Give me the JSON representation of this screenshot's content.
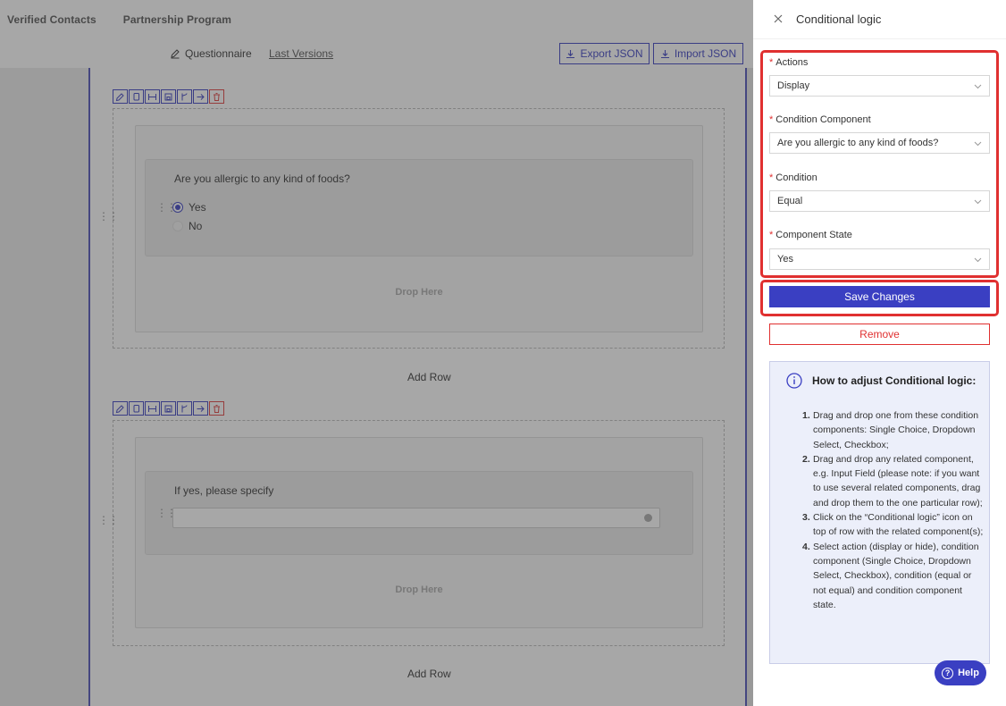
{
  "topnav": {
    "items": [
      "Verified Contacts",
      "Partnership Program"
    ]
  },
  "subbar": {
    "questionnaire_tab": "Questionnaire",
    "last_versions_tab": "Last Versions",
    "export_label": "Export JSON",
    "import_label": "Import JSON"
  },
  "form": {
    "row1": {
      "question": "Are you allergic to any kind of foods?",
      "options": [
        "Yes",
        "No"
      ],
      "selected": "Yes",
      "drop_here": "Drop Here",
      "add_row": "Add Row"
    },
    "row2": {
      "question": "If yes, please specify",
      "input_value": "",
      "drop_here": "Drop Here",
      "add_row": "Add Row"
    }
  },
  "panel": {
    "title": "Conditional logic",
    "fields": [
      {
        "label": "Actions",
        "value": "Display"
      },
      {
        "label": "Condition Component",
        "value": "Are you allergic to any kind of foods?"
      },
      {
        "label": "Condition",
        "value": "Equal"
      },
      {
        "label": "Component State",
        "value": "Yes"
      }
    ],
    "save_label": "Save Changes",
    "remove_label": "Remove",
    "help": {
      "title": "How to adjust Conditional logic:",
      "steps": [
        "Drag and drop one from these condition components: Single Choice, Dropdown Select, Checkbox;",
        "Drag and drop any related component, e.g. Input Field (please note: if you want to use several related components, drag and drop them to the one particular row);",
        "Click on the “Conditional logic” icon on top of row with the related component(s);",
        "Select action (display or hide), condition component (Single Choice, Dropdown Select, Checkbox), condition (equal or not equal) and condition component state."
      ]
    },
    "help_button": "Help"
  },
  "colors": {
    "accent": "#3a3fc2",
    "danger": "#e03030"
  }
}
